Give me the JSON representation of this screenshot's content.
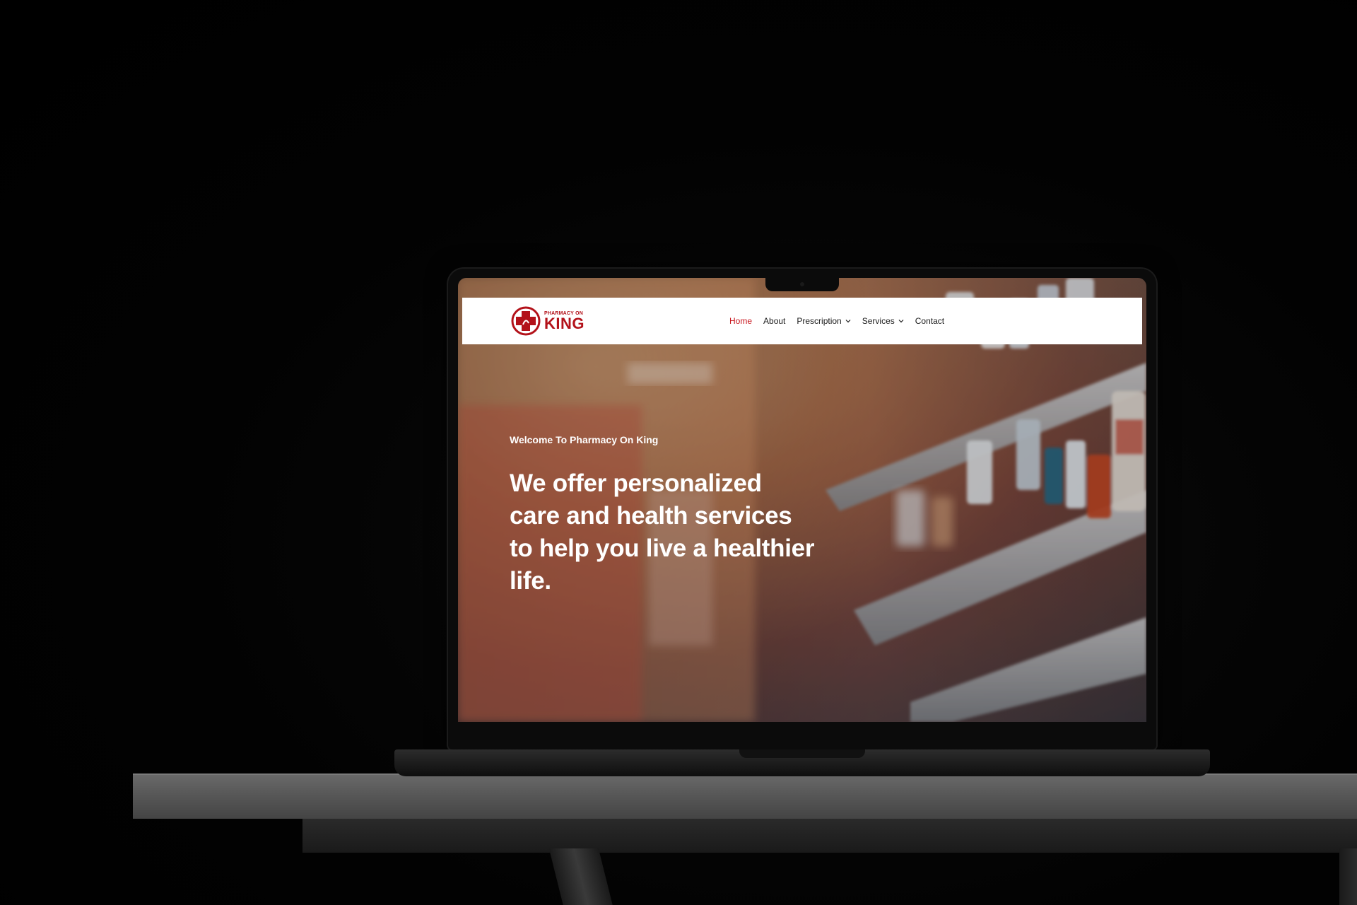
{
  "site": {
    "logo": {
      "small_text": "PHARMACY ON",
      "big_text": "KING"
    },
    "nav": {
      "items": [
        {
          "label": "Home",
          "active": true,
          "has_dropdown": false
        },
        {
          "label": "About",
          "active": false,
          "has_dropdown": false
        },
        {
          "label": "Prescription",
          "active": false,
          "has_dropdown": true
        },
        {
          "label": "Services",
          "active": false,
          "has_dropdown": true
        },
        {
          "label": "Contact",
          "active": false,
          "has_dropdown": false
        }
      ]
    },
    "hero": {
      "eyebrow": "Welcome To Pharmacy On King",
      "headline_lines": [
        "We offer personalized",
        "care and health services",
        "to help you live a healthier",
        "life."
      ]
    }
  },
  "colors": {
    "brand_red": "#c8141c",
    "nav_text": "#1a1a1a",
    "header_bg": "#ffffff",
    "hero_text": "#ffffff"
  },
  "icons": {
    "logo_mark": "medical-cross-icon",
    "dropdown": "chevron-down-icon",
    "camera": "camera-icon"
  }
}
